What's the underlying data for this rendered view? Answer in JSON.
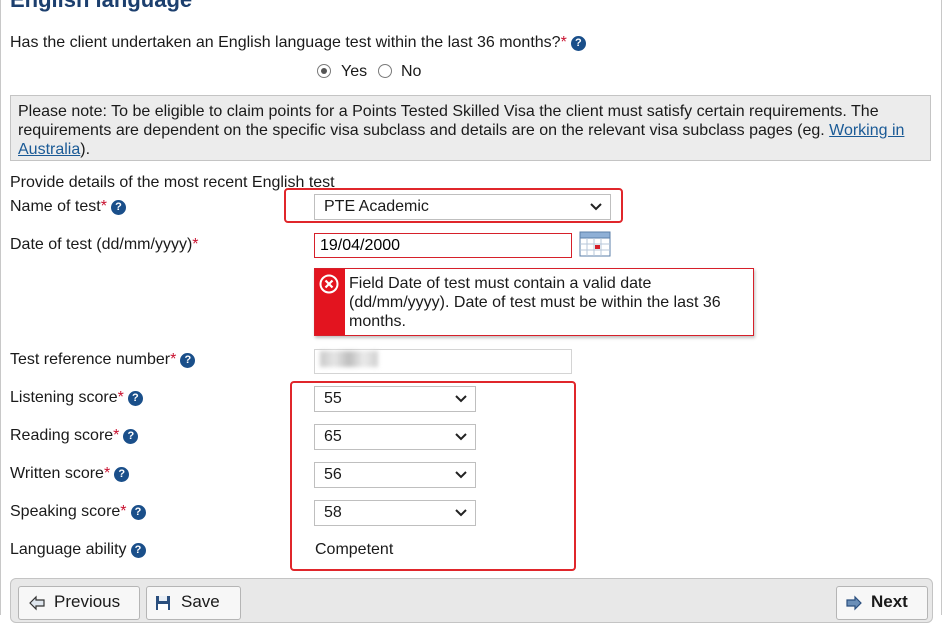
{
  "section": {
    "title": "English language"
  },
  "question": {
    "text": "Has the client undertaken an English language test within the last 36 months?",
    "required_mark": "*",
    "options": [
      "Yes",
      "No"
    ],
    "selected": "Yes"
  },
  "note": {
    "text": "Please note: To be eligible to claim points for a Points Tested Skilled Visa the client must satisfy certain requirements. The requirements are dependent on the specific visa subclass and details are on the relevant visa subclass pages (eg. ",
    "link": "Working in Australia",
    "suffix": ")."
  },
  "details_heading": "Provide details of the most recent English test",
  "fields": {
    "test_name": {
      "label": "Name of test",
      "value": "PTE Academic"
    },
    "test_date": {
      "label": "Date of test (dd/mm/yyyy)",
      "value": "19/04/2000"
    },
    "test_reference": {
      "label": "Test reference number"
    },
    "listening": {
      "label": "Listening score",
      "value": "55"
    },
    "reading": {
      "label": "Reading score",
      "value": "65"
    },
    "written": {
      "label": "Written score",
      "value": "56"
    },
    "speaking": {
      "label": "Speaking score",
      "value": "58"
    },
    "language_ability": {
      "label": "Language ability",
      "value": "Competent"
    }
  },
  "required_mark": "*",
  "help_glyph": "?",
  "error": {
    "message": "Field Date of test must contain a valid date (dd/mm/yyyy). Date of test must be within the last 36 months."
  },
  "buttons": {
    "previous": "Previous",
    "save": "Save",
    "next": "Next"
  },
  "colors": {
    "accent": "#1c3f6e",
    "error": "#e3141f",
    "link": "#1a5a96"
  }
}
